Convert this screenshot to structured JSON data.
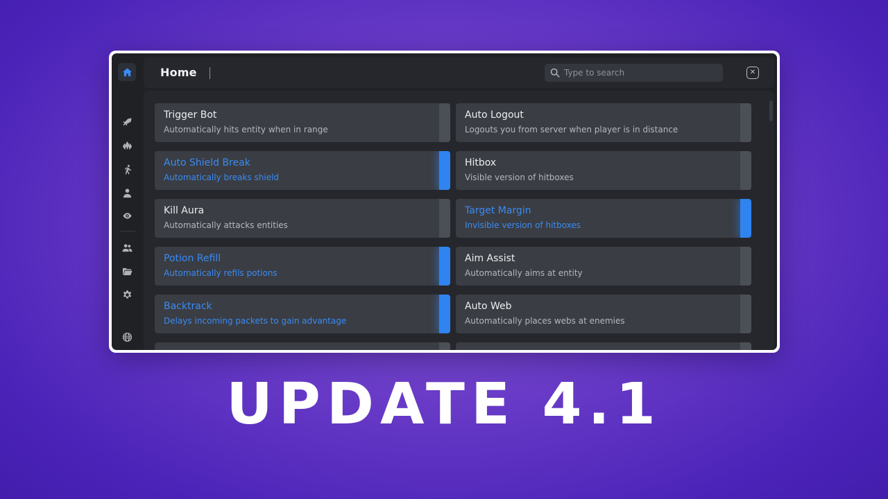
{
  "header": {
    "title": "Home",
    "search_placeholder": "Type to search"
  },
  "sidebar": {
    "items": [
      {
        "name": "home",
        "icon": "home-icon",
        "active": true
      },
      {
        "name": "combat",
        "icon": "sword-icon"
      },
      {
        "name": "world",
        "icon": "crystal-icon"
      },
      {
        "name": "movement",
        "icon": "running-icon"
      },
      {
        "name": "player",
        "icon": "person-icon"
      },
      {
        "name": "render",
        "icon": "eye-icon"
      },
      {
        "name": "friends",
        "icon": "users-icon"
      },
      {
        "name": "configs",
        "icon": "folder-icon"
      },
      {
        "name": "settings",
        "icon": "gear-icon"
      },
      {
        "name": "hud-editor",
        "icon": "globe-grid-icon"
      }
    ]
  },
  "modules": [
    {
      "name": "Trigger Bot",
      "desc": "Automatically hits entity when in range",
      "enabled": false
    },
    {
      "name": "Auto Logout",
      "desc": "Logouts you from server when player is in distance",
      "enabled": false
    },
    {
      "name": "Auto Shield Break",
      "desc": "Automatically breaks shield",
      "enabled": true
    },
    {
      "name": "Hitbox",
      "desc": "Visible version of hitboxes",
      "enabled": false
    },
    {
      "name": "Kill Aura",
      "desc": "Automatically attacks entities",
      "enabled": false
    },
    {
      "name": "Target Margin",
      "desc": "Invisible version of hitboxes",
      "enabled": true
    },
    {
      "name": "Potion Refill",
      "desc": "Automatically refils potions",
      "enabled": true
    },
    {
      "name": "Aim Assist",
      "desc": "Automatically aims at entity",
      "enabled": false
    },
    {
      "name": "Backtrack",
      "desc": "Delays incoming packets to gain advantage",
      "enabled": true
    },
    {
      "name": "Auto Web",
      "desc": "Automatically places webs at enemies",
      "enabled": false
    }
  ],
  "colors": {
    "accent": "#2f84f0",
    "card": "#3a3d43",
    "panel": "#25272c",
    "background": "#6a3cc8"
  },
  "headline": "UPDATE 4.1"
}
